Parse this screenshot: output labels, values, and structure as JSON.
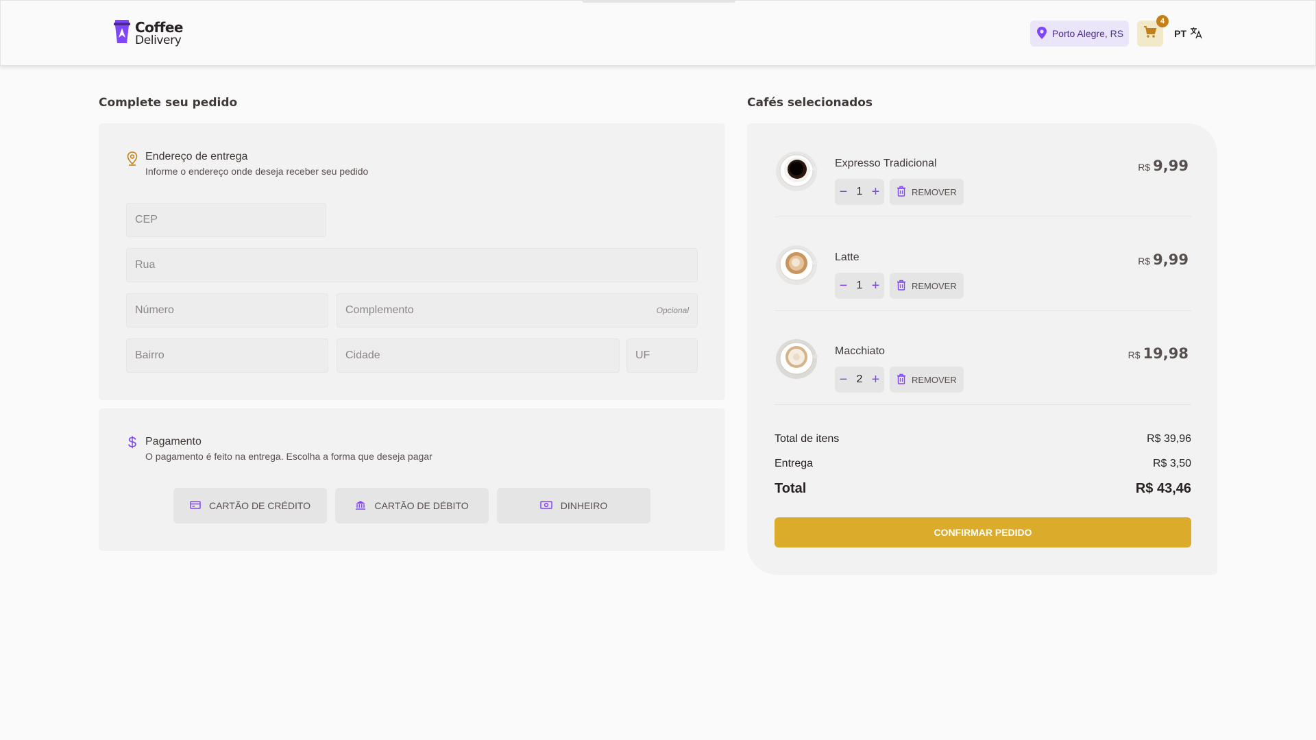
{
  "header": {
    "logo_line1": "Coffee",
    "logo_line2": "Delivery",
    "location": "Porto Alegre, RS",
    "cart_count": "4",
    "language": "PT"
  },
  "order": {
    "title": "Complete seu pedido",
    "address": {
      "title": "Endereço de entrega",
      "subtitle": "Informe o endereço onde deseja receber seu pedido",
      "cep_placeholder": "CEP",
      "rua_placeholder": "Rua",
      "numero_placeholder": "Número",
      "complemento_placeholder": "Complemento",
      "complemento_optional": "Opcional",
      "bairro_placeholder": "Bairro",
      "cidade_placeholder": "Cidade",
      "uf_placeholder": "UF"
    },
    "payment": {
      "title": "Pagamento",
      "subtitle": "O pagamento é feito na entrega. Escolha a forma que deseja pagar",
      "options": [
        "CARTÃO DE CRÉDITO",
        "CARTÃO DE DÉBITO",
        "DINHEIRO"
      ]
    }
  },
  "cart": {
    "title": "Cafés selecionados",
    "remove_label": "REMOVER",
    "currency": "R$",
    "items": [
      {
        "name": "Expresso Tradicional",
        "quantity": "1",
        "price": "9,99"
      },
      {
        "name": "Latte",
        "quantity": "1",
        "price": "9,99"
      },
      {
        "name": "Macchiato",
        "quantity": "2",
        "price": "19,98"
      }
    ],
    "items_total_label": "Total de itens",
    "items_total_value": "R$ 39,96",
    "delivery_label": "Entrega",
    "delivery_value": "R$ 3,50",
    "total_label": "Total",
    "total_value": "R$ 43,46",
    "confirm_label": "CONFIRMAR PEDIDO"
  },
  "colors": {
    "purple": "#8047F8",
    "yellow": "#DBAC2C",
    "yellow_dark": "#C47F17"
  }
}
